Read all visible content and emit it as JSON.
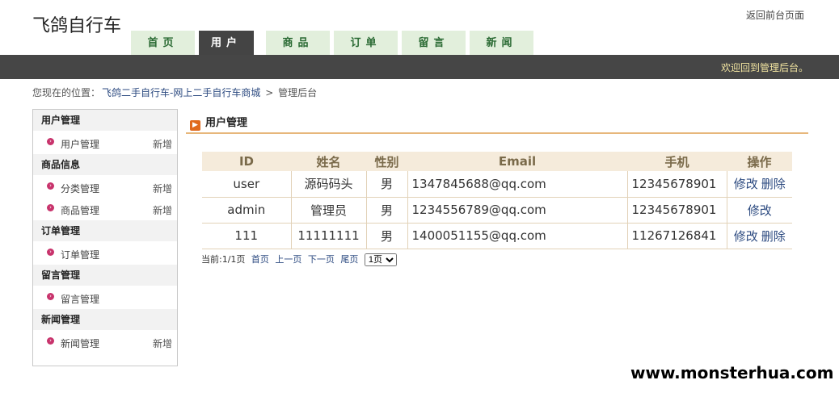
{
  "header": {
    "site_title": "飞鸽自行车",
    "home_link": "返回前台页面"
  },
  "nav": {
    "tabs": [
      {
        "label": "首页"
      },
      {
        "label": "用户"
      },
      {
        "label": "商品"
      },
      {
        "label": "订单"
      },
      {
        "label": "留言"
      },
      {
        "label": "新闻"
      }
    ]
  },
  "topbar": {
    "welcome": "欢迎回到管理后台。"
  },
  "breadcrumb": {
    "prefix": "您现在的位置：",
    "link": "飞鸽二手自行车-网上二手自行车商城",
    "sep": ">",
    "current": "管理后台"
  },
  "sidebar": {
    "groups": [
      {
        "title": "用户管理",
        "items": [
          {
            "label": "用户管理",
            "add": "新增"
          }
        ]
      },
      {
        "title": "商品信息",
        "items": [
          {
            "label": "分类管理",
            "add": "新增"
          },
          {
            "label": "商品管理",
            "add": "新增"
          }
        ]
      },
      {
        "title": "订单管理",
        "items": [
          {
            "label": "订单管理"
          }
        ]
      },
      {
        "title": "留言管理",
        "items": [
          {
            "label": "留言管理"
          }
        ]
      },
      {
        "title": "新闻管理",
        "items": [
          {
            "label": "新闻管理",
            "add": "新增"
          }
        ]
      }
    ]
  },
  "main": {
    "title": "用户管理",
    "table": {
      "headers": [
        "ID",
        "姓名",
        "性别",
        "Email",
        "手机",
        "操作"
      ],
      "rows": [
        {
          "id": "user",
          "name": "源码码头",
          "gender": "男",
          "email": "1347845688@qq.com",
          "phone": "12345678901",
          "edit": "修改",
          "delete": "删除"
        },
        {
          "id": "admin",
          "name": "管理员",
          "gender": "男",
          "email": "1234556789@qq.com",
          "phone": "12345678901",
          "edit": "修改"
        },
        {
          "id": "111",
          "name": "11111111",
          "gender": "男",
          "email": "1400051155@qq.com",
          "phone": "11267126841",
          "edit": "修改",
          "delete": "删除"
        }
      ]
    },
    "pager": {
      "status": "当前:1/1页",
      "first": "首页",
      "prev": "上一页",
      "next": "下一页",
      "last": "尾页",
      "select_value": "1页"
    }
  },
  "watermark": "www.monsterhua.com"
}
